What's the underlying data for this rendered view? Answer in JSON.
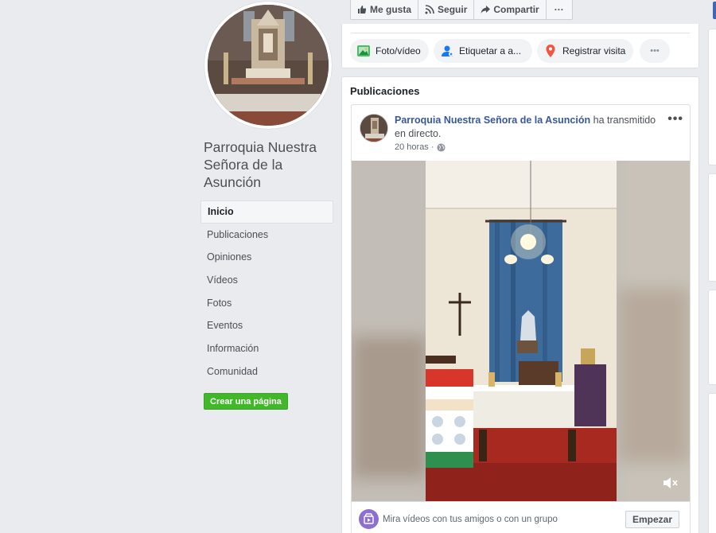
{
  "page": {
    "name": "Parroquia Nuestra Señora de la Asunción"
  },
  "nav": {
    "items": [
      {
        "label": "Inicio",
        "active": true
      },
      {
        "label": "Publicaciones"
      },
      {
        "label": "Opiniones"
      },
      {
        "label": "Vídeos"
      },
      {
        "label": "Fotos"
      },
      {
        "label": "Eventos"
      },
      {
        "label": "Información"
      },
      {
        "label": "Comunidad"
      }
    ],
    "create_page": "Crear una página"
  },
  "actions": {
    "like": "Me gusta",
    "follow": "Seguir",
    "share": "Compartir",
    "more": "···"
  },
  "compose": {
    "photo_video": "Foto/vídeo",
    "tag": "Etiquetar a a...",
    "checkin": "Registrar visita",
    "more": "•••"
  },
  "posts": {
    "title": "Publicaciones",
    "post": {
      "author": "Parroquia Nuestra Señora de la Asunción",
      "action": " ha transmitido en directo.",
      "time": "20 horas · ",
      "more": "•••"
    },
    "watch": {
      "text": "Mira vídeos con tus amigos o con un grupo",
      "button": "Empezar"
    }
  },
  "colors": {
    "link": "#385898",
    "green_button": "#42b72a",
    "brand_blue": "#4267b2",
    "background": "#e9ebee"
  }
}
